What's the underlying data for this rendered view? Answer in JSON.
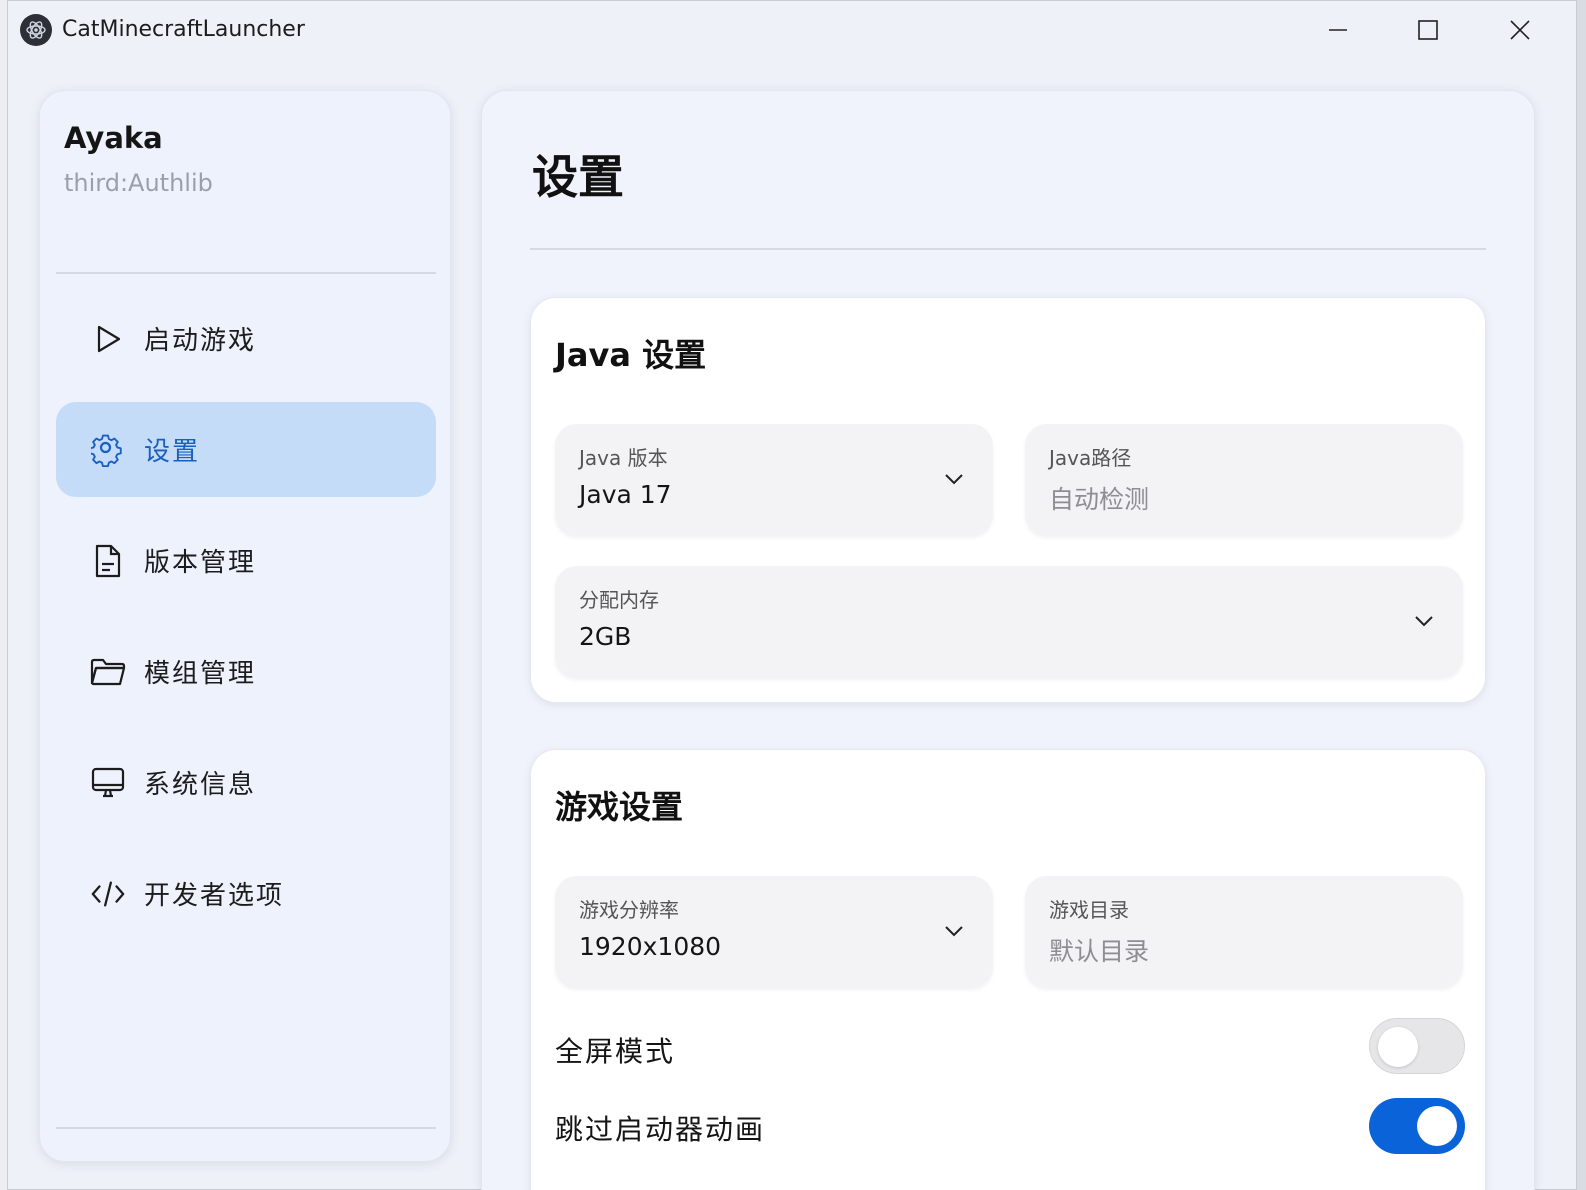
{
  "window": {
    "title": "CatMinecraftLauncher",
    "controls": [
      "minimize",
      "maximize",
      "close"
    ]
  },
  "sidebar": {
    "user_name": "Ayaka",
    "user_type": "third:Authlib",
    "items": [
      {
        "label": "启动游戏",
        "icon": "play-icon",
        "active": false
      },
      {
        "label": "设置",
        "icon": "gear-icon",
        "active": true
      },
      {
        "label": "版本管理",
        "icon": "document-icon",
        "active": false
      },
      {
        "label": "模组管理",
        "icon": "folder-icon",
        "active": false
      },
      {
        "label": "系统信息",
        "icon": "monitor-icon",
        "active": false
      },
      {
        "label": "开发者选项",
        "icon": "code-icon",
        "active": false
      }
    ]
  },
  "main": {
    "page_title": "设置",
    "java_card": {
      "title": "Java 设置",
      "java_version": {
        "label": "Java 版本",
        "value": "Java 17"
      },
      "java_path": {
        "label": "Java路径",
        "value": "自动检测"
      },
      "memory": {
        "label": "分配内存",
        "value": "2GB"
      }
    },
    "game_card": {
      "title": "游戏设置",
      "resolution": {
        "label": "游戏分辨率",
        "value": "1920x1080"
      },
      "game_dir": {
        "label": "游戏目录",
        "value": "默认目录"
      },
      "fullscreen": {
        "label": "全屏模式",
        "enabled": false
      },
      "skip_animation": {
        "label": "跳过启动器动画",
        "enabled": true
      }
    }
  },
  "colors": {
    "accent": "#0a63d8",
    "active_nav_bg": "#c4dcf8",
    "active_nav_text": "#1a5fbf"
  }
}
